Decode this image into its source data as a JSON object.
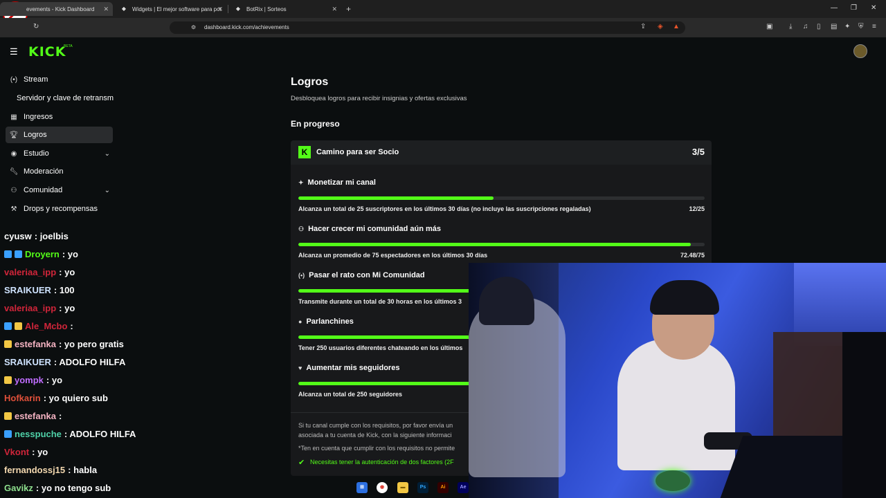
{
  "browser": {
    "tabs": [
      {
        "label": "evements - Kick Dashboard"
      },
      {
        "label": "Widgets | El mejor software para pot"
      },
      {
        "label": "BotRix | Sorteos"
      }
    ],
    "url": "dashboard.kick.com/achievements"
  },
  "header": {
    "logo": "KICK",
    "beta": "BETA"
  },
  "sidebar": {
    "items": [
      {
        "label": "Stream",
        "icon": "broadcast-icon"
      },
      {
        "label": "Servidor y clave de retransm",
        "icon": ""
      },
      {
        "label": "Ingresos",
        "icon": "chart-icon"
      },
      {
        "label": "Logros",
        "icon": "trophy-icon"
      },
      {
        "label": "Estudio",
        "icon": "palette-icon"
      },
      {
        "label": "Moderación",
        "icon": "wrench-icon"
      },
      {
        "label": "Comunidad",
        "icon": "users-icon"
      },
      {
        "label": "Drops y recompensas",
        "icon": "gift-icon"
      }
    ]
  },
  "chat": [
    {
      "user": "cyusw",
      "msg": ": joelbis",
      "color": "#ffffff"
    },
    {
      "user": "Droyern",
      "msg": ": yo",
      "color": "#53fc18"
    },
    {
      "user": "valeriaa_ipp",
      "msg": ": yo",
      "color": "#d1253a"
    },
    {
      "user": "SRAIKUER",
      "msg": ": 100",
      "color": "#cfe3ff"
    },
    {
      "user": "valeriaa_ipp",
      "msg": ": yo",
      "color": "#d1253a"
    },
    {
      "user": "Ale_Mcbo",
      "msg": ":",
      "color": "#d1253a"
    },
    {
      "user": "estefanka",
      "msg": ": yo pero gratis",
      "color": "#f4b3c2"
    },
    {
      "user": "SRAIKUER",
      "msg": ": ADOLFO HILFA",
      "color": "#cfe3ff"
    },
    {
      "user": "yompk",
      "msg": ": yo",
      "color": "#c06dff"
    },
    {
      "user": "Hofkarin",
      "msg": ": yo quiero sub",
      "color": "#e0503a"
    },
    {
      "user": "estefanka",
      "msg": ":",
      "color": "#f4b3c2"
    },
    {
      "user": "nesspuche",
      "msg": ": ADOLFO HILFA",
      "color": "#4fd1a8"
    },
    {
      "user": "Vkont",
      "msg": ": yo",
      "color": "#d1253a"
    },
    {
      "user": "fernandossj15",
      "msg": ": habla",
      "color": "#f4d9b0"
    },
    {
      "user": "Gavikz",
      "msg": ": yo no tengo sub",
      "color": "#8ee08e"
    }
  ],
  "main": {
    "title": "Logros",
    "subtitle": "Desbloquea logros para recibir insignias y ofertas exclusivas",
    "section": "En progreso",
    "card": {
      "title": "Camino para ser Socio",
      "count": "3/5",
      "achievements": [
        {
          "title": "Monetizar mi canal",
          "icon": "sparkle-icon",
          "desc": "Alcanza un total de 25 suscriptores en los últimos 30 días (no incluye las suscripciones regaladas)",
          "value": "12/25",
          "progress": 0.48
        },
        {
          "title": "Hacer crecer mi comunidad aún más",
          "icon": "users-icon",
          "desc": "Alcanza un promedio de 75 espectadores en los últimos 30 días",
          "value": "72.48/75",
          "progress": 0.966
        },
        {
          "title": "Pasar el rato con Mi Comunidad",
          "icon": "broadcast-icon",
          "desc": "Transmite durante un total de 30 horas en los últimos 3",
          "value": "",
          "progress": 1.0
        },
        {
          "title": "Parlanchines",
          "icon": "chat-icon",
          "desc": "Tener 250 usuarios diferentes chateando en los últimos",
          "value": "",
          "progress": 1.0
        },
        {
          "title": "Aumentar mis seguidores",
          "icon": "heart-icon",
          "desc": "Alcanza un total de 250 seguidores",
          "value": "",
          "progress": 1.0
        }
      ],
      "footer1": "Si tu canal cumple con los requisitos, por favor envía un",
      "footer2": "asociada a tu cuenta de Kick, con la siguiente informaci",
      "footer3": "*Ten en cuenta que cumplir con los requisitos no permite",
      "footer4": "Necesitas tener la autenticación de dos factores (2F"
    }
  },
  "taskbar": {
    "apps": [
      "Ps",
      "Ai",
      "Ae"
    ]
  },
  "colors": {
    "accent": "#53fc18",
    "bg": "#0b0e0f",
    "card": "#18191b"
  }
}
